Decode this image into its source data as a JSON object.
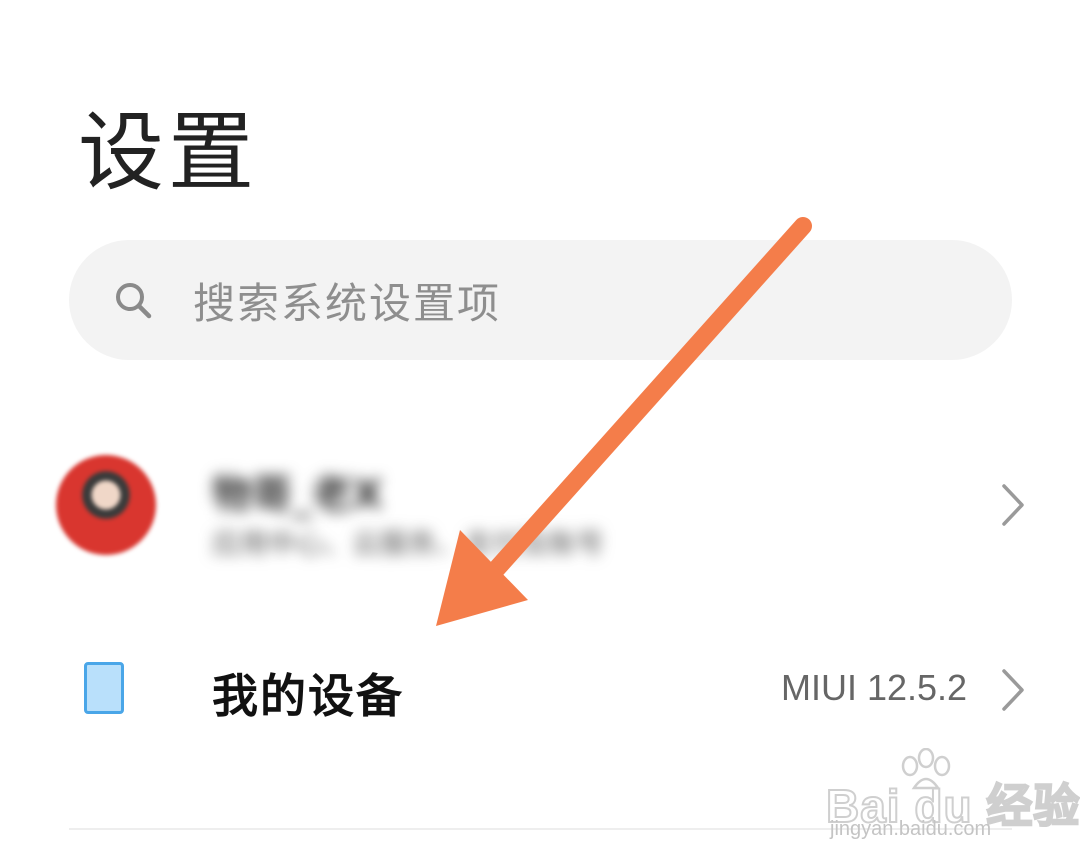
{
  "page": {
    "title": "设置"
  },
  "search": {
    "placeholder": "搜索系统设置项",
    "icon": "search-icon"
  },
  "account": {
    "name": "物哥_老X",
    "subtitle": "应用中心、云服务、支付及账号",
    "avatar_color": "#d9362f"
  },
  "device": {
    "icon": "phone-icon",
    "icon_color": "#4aa6e8",
    "label": "我的设备",
    "value": "MIUI 12.5.2"
  },
  "annotation": {
    "arrow_color": "#f47d4a"
  },
  "watermark": {
    "brand": "Bai du 经验",
    "url": "jingyan.baidu.com"
  }
}
